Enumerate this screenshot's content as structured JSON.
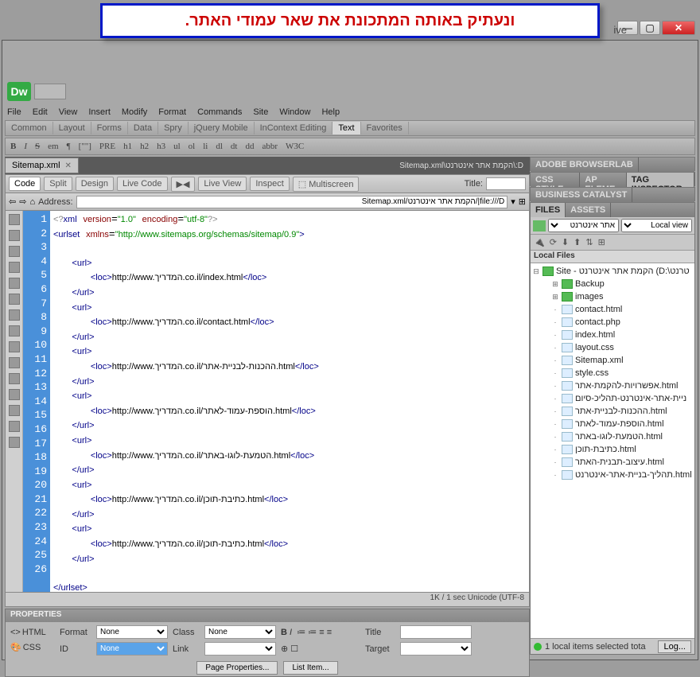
{
  "banner_text": "ונעתיק באותה המתכונת את שאר עמודי האתר.",
  "title_suffix": "ive",
  "menu": {
    "file": "File",
    "edit": "Edit",
    "view": "View",
    "insert": "Insert",
    "modify": "Modify",
    "format": "Format",
    "commands": "Commands",
    "site": "Site",
    "window": "Window",
    "help": "Help"
  },
  "insert_tabs": {
    "common": "Common",
    "layout": "Layout",
    "forms": "Forms",
    "data": "Data",
    "spry": "Spry",
    "jquery": "jQuery Mobile",
    "incontext": "InContext Editing",
    "text": "Text",
    "favorites": "Favorites"
  },
  "fmt": {
    "b": "B",
    "i": "I",
    "s": "S",
    "em": "em",
    "para": "¶",
    "bq": "[\"\"]",
    "pre": "PRE",
    "h1": "h1",
    "h2": "h2",
    "h3": "h3",
    "ul": "ul",
    "ol": "ol",
    "li": "li",
    "dl": "dl",
    "dt": "dt",
    "dd": "dd",
    "abbr": "abbr",
    "wrc": "W3C"
  },
  "doc": {
    "tab_name": "Sitemap.xml",
    "path": "D:\\הקמת אתר אינטרנט\\Sitemap.xml"
  },
  "docbar": {
    "code": "Code",
    "split": "Split",
    "design": "Design",
    "livecode": "Live Code",
    "liveview": "Live View",
    "inspect": "Inspect",
    "multiscreen": "Multiscreen",
    "title": "Title:"
  },
  "address": {
    "label": "Address:",
    "value": "file:///D|/הקמת אתר אינטרנט/Sitemap.xml"
  },
  "code_lines": [
    {
      "n": 1,
      "h": "<span class='d'>&lt;?</span><span class='t'>xml</span> <span class='a'>version</span>=<span class='v'>\"1.0\"</span> <span class='a'>encoding</span>=<span class='v'>\"utf-8\"</span><span class='d'>?&gt;</span>"
    },
    {
      "n": 2,
      "h": "<span class='t'>&lt;urlset</span> <span class='a'>xmlns</span>=<span class='v'>\"http://www.sitemaps.org/schemas/sitemap/0.9\"</span><span class='t'>&gt;</span>"
    },
    {
      "n": 3,
      "h": ""
    },
    {
      "n": 4,
      "h": "   <span class='t'>&lt;url&gt;</span>"
    },
    {
      "n": 5,
      "h": "      <span class='t'>&lt;loc&gt;</span><span class='c'>http://www.המדריך.co.il/index.html</span><span class='t'>&lt;/loc&gt;</span>"
    },
    {
      "n": 6,
      "h": "   <span class='t'>&lt;/url&gt;</span>"
    },
    {
      "n": 7,
      "h": "   <span class='t'>&lt;url&gt;</span>"
    },
    {
      "n": 8,
      "h": "      <span class='t'>&lt;loc&gt;</span><span class='c'>http://www.המדריך.co.il/contact.html</span><span class='t'>&lt;/loc&gt;</span>"
    },
    {
      "n": 9,
      "h": "   <span class='t'>&lt;/url&gt;</span>"
    },
    {
      "n": 10,
      "h": "   <span class='t'>&lt;url&gt;</span>"
    },
    {
      "n": 11,
      "h": "      <span class='t'>&lt;loc&gt;</span><span class='c'>http://www.המדריך.co.il/ההכנות-לבניית-אתר.html</span><span class='t'>&lt;/loc&gt;</span>"
    },
    {
      "n": 12,
      "h": "   <span class='t'>&lt;/url&gt;</span>"
    },
    {
      "n": 13,
      "h": "   <span class='t'>&lt;url&gt;</span>"
    },
    {
      "n": 14,
      "h": "      <span class='t'>&lt;loc&gt;</span><span class='c'>http://www.המדריך.co.il/הוספת-עמוד-לאתר.html</span><span class='t'>&lt;/loc&gt;</span>"
    },
    {
      "n": 15,
      "h": "   <span class='t'>&lt;/url&gt;</span>"
    },
    {
      "n": 16,
      "h": "   <span class='t'>&lt;url&gt;</span>"
    },
    {
      "n": 17,
      "h": "      <span class='t'>&lt;loc&gt;</span><span class='c'>http://www.המדריך.co.il/הטמעת-לוגו-באתר.html</span><span class='t'>&lt;/loc&gt;</span>"
    },
    {
      "n": 18,
      "h": "   <span class='t'>&lt;/url&gt;</span>"
    },
    {
      "n": 19,
      "h": "   <span class='t'>&lt;url&gt;</span>"
    },
    {
      "n": 20,
      "h": "      <span class='t'>&lt;loc&gt;</span><span class='c'>http://www.המדריך.co.il/כתיבת-תוכן.html</span><span class='t'>&lt;/loc&gt;</span>"
    },
    {
      "n": 21,
      "h": "   <span class='t'>&lt;/url&gt;</span>"
    },
    {
      "n": 22,
      "h": "   <span class='t'>&lt;url&gt;</span>"
    },
    {
      "n": 23,
      "h": "      <span class='t'>&lt;loc&gt;</span><span class='c'>http://www.המדריך.co.il/כתיבת-תוכן.html</span><span class='t'>&lt;/loc&gt;</span>"
    },
    {
      "n": 24,
      "h": "   <span class='t'>&lt;/url&gt;</span>"
    },
    {
      "n": 25,
      "h": ""
    },
    {
      "n": 26,
      "h": "<span class='t'>&lt;/urlset&gt;</span>"
    }
  ],
  "status": "1K / 1 sec  Unicode (UTF-8",
  "props": {
    "header": "PROPERTIES",
    "html": "HTML",
    "css": "CSS",
    "format": "Format",
    "format_v": "None",
    "class": "Class",
    "class_v": "None",
    "title": "Title",
    "id": "ID",
    "id_v": "None",
    "link": "Link",
    "target": "Target",
    "pageprops": "Page Properties...",
    "listitem": "List Item..."
  },
  "rpanels": {
    "browserlab": "ADOBE BROWSERLAB",
    "cssstyle": "CSS STYLE",
    "apelem": "AP ELEME",
    "taginsp": "TAG INSPECTOR",
    "bizcat": "BUSINESS CATALYST",
    "files": "FILES",
    "assets": "ASSETS"
  },
  "site": {
    "name": "אתר אינטרנט",
    "view": "Local view",
    "localfiles": "Local Files",
    "root": "Site - הקמת אתר אינטרנט (D:\\טרנט"
  },
  "files": [
    "Backup",
    "images",
    "contact.html",
    "contact.php",
    "index.html",
    "layout.css",
    "Sitemap.xml",
    "style.css",
    "אפשרויות-להקמת-אתר.html",
    "ניית-אתר-אינטרנט-תהליכ-סיום",
    "ההכנות-לבניית-אתר.html",
    "הוספת-עמוד-לאתר.html",
    "הטמעת-לוגו-באתר.html",
    "כתיבת-תוכן.html",
    "עיצוב-תבנית-האתר.html",
    "תהליך-בניית-אתר-אינטרנט.html"
  ],
  "file_types": [
    "folder",
    "folder",
    "file",
    "file",
    "file",
    "file",
    "file",
    "file",
    "file",
    "file",
    "file",
    "file",
    "file",
    "file",
    "file",
    "file"
  ],
  "bottomstat": {
    "text": "1 local items selected tota",
    "log": "Log..."
  }
}
